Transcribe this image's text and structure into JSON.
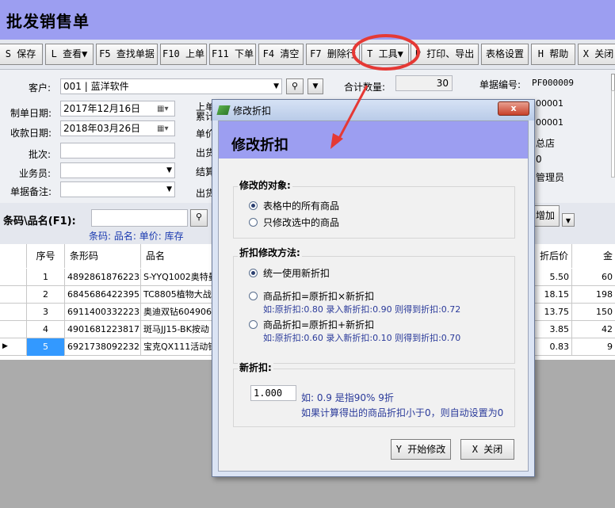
{
  "window_title": "批发销售单",
  "toolbar": [
    {
      "key": "save",
      "label": "S 保存"
    },
    {
      "key": "view",
      "label": "L 查看▼"
    },
    {
      "key": "find",
      "label": "F5 查找单据"
    },
    {
      "key": "prev",
      "label": "F10 上单"
    },
    {
      "key": "next",
      "label": "F11 下单"
    },
    {
      "key": "clear",
      "label": "F4 清空"
    },
    {
      "key": "delete",
      "label": "F7 删除行"
    },
    {
      "key": "tools",
      "label": "T 工具▼"
    },
    {
      "key": "print",
      "label": "P 打印、导出"
    },
    {
      "key": "table",
      "label": "表格设置"
    },
    {
      "key": "help",
      "label": "H 帮助"
    },
    {
      "key": "close",
      "label": "X 关闭"
    }
  ],
  "form": {
    "customer_label": "客户:",
    "customer_value": "001 | 蓝洋软件",
    "date_label": "制单日期:",
    "date_value": "2017年12月16日",
    "due_label": "收款日期:",
    "due_value": "2018年03月26日",
    "batch_label": "批次:",
    "staff_label": "业务员:",
    "note_label": "单据备注:",
    "mid_labels": [
      "上单",
      "累计",
      "单价",
      "出货",
      "结算",
      "出货"
    ],
    "qty_label": "合计数量:",
    "qty_value": "30",
    "docno_label": "单据编号:",
    "docno_value": "PF000009",
    "right_values": [
      "00001",
      "00001",
      "总店",
      "0",
      "管理员"
    ]
  },
  "search": {
    "label": "条码\\品名(F1):",
    "hint": "条码: 品名: 单价: 库存",
    "add_label": "增加"
  },
  "grid": {
    "headers": [
      "序号",
      "条形码",
      "品名",
      "折后价",
      "金"
    ],
    "rows": [
      {
        "no": "1",
        "barcode": "4892861876223",
        "name": "S-YYQ1002奥特曼",
        "price": "5.50",
        "amount": "60"
      },
      {
        "no": "2",
        "barcode": "6845686422395",
        "name": "TC8805植物大战",
        "price": "18.15",
        "amount": "198"
      },
      {
        "no": "3",
        "barcode": "6911400332223",
        "name": "奥迪双钻604906",
        "price": "13.75",
        "amount": "150"
      },
      {
        "no": "4",
        "barcode": "4901681223817",
        "name": "斑马JJ15-BK按动",
        "price": "3.85",
        "amount": "42"
      },
      {
        "no": "5",
        "barcode": "6921738092232",
        "name": "宝克QX111活动铅",
        "price": "0.83",
        "amount": "9"
      }
    ]
  },
  "dialog": {
    "title": "修改折扣",
    "close": "x",
    "heading": "修改折扣",
    "target_title": "修改的对象:",
    "target_options": [
      "表格中的所有商品",
      "只修改选中的商品"
    ],
    "method_title": "折扣修改方法:",
    "method_option1": "统一使用新折扣",
    "method_option2": "商品折扣=原折扣×新折扣",
    "method_hint2": "如:原折扣:0.80  录入新折扣:0.90  则得到折扣:0.72",
    "method_option3": "商品折扣=原折扣+新折扣",
    "method_hint3": "如:原折扣:0.60  录入新折扣:0.10  则得到折扣:0.70",
    "newdisc_title": "新折扣:",
    "newdisc_value": "1.000",
    "newdisc_hint1": "如: 0.9 是指90%  9折",
    "newdisc_hint2": "如果计算得出的商品折扣小于0，则自动设置为0",
    "start_button": "Y 开始修改",
    "close_button": "X 关闭"
  },
  "colors": {
    "accent": "#9c9ef1",
    "annotation": "#e53935",
    "selected_row": "#3399ff"
  }
}
